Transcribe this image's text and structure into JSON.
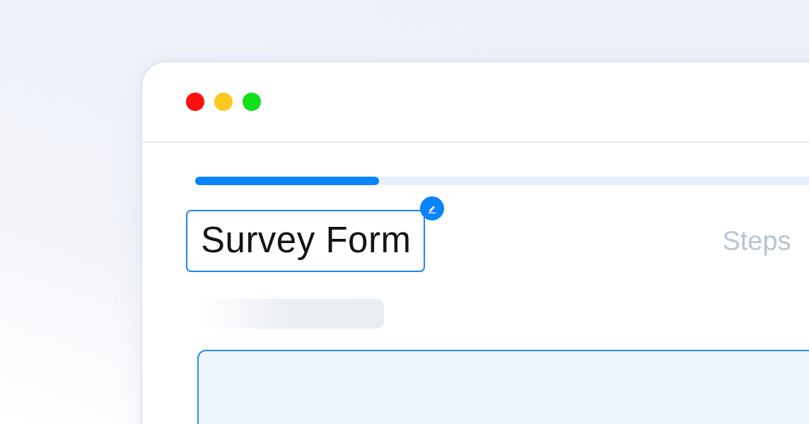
{
  "window": {
    "controls": [
      {
        "color": "#ff0f0f"
      },
      {
        "color": "#fec822"
      },
      {
        "color": "#11e01a"
      }
    ]
  },
  "progress": {
    "level": 0.26
  },
  "form": {
    "title": "Survey Form",
    "steps_label": "Steps"
  }
}
